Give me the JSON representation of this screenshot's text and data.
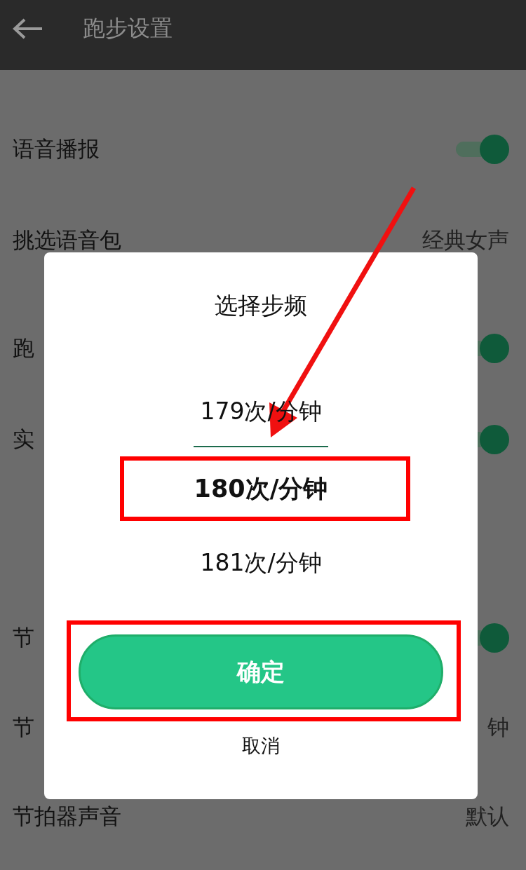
{
  "header": {
    "title": "跑步设置"
  },
  "settings": [
    {
      "label": "语音播报",
      "kind": "toggle",
      "on": true
    },
    {
      "label": "挑选语音包",
      "kind": "value",
      "value": "经典女声"
    },
    {
      "label": "跑",
      "kind": "toggle",
      "on": true
    },
    {
      "label": "实",
      "kind": "toggle",
      "on": true
    },
    {
      "label": "节",
      "kind": "toggle",
      "on": true
    },
    {
      "label": "节",
      "kind": "value",
      "value": "钟"
    },
    {
      "label": "节拍器声音",
      "kind": "value",
      "value": "默认"
    }
  ],
  "dialog": {
    "title": "选择步频",
    "options": [
      {
        "label": "179次/分钟",
        "selected": false
      },
      {
        "label": "180次/分钟",
        "selected": true
      },
      {
        "label": "181次/分钟",
        "selected": false
      }
    ],
    "confirm_button": "确定",
    "cancel_button": "取消"
  }
}
